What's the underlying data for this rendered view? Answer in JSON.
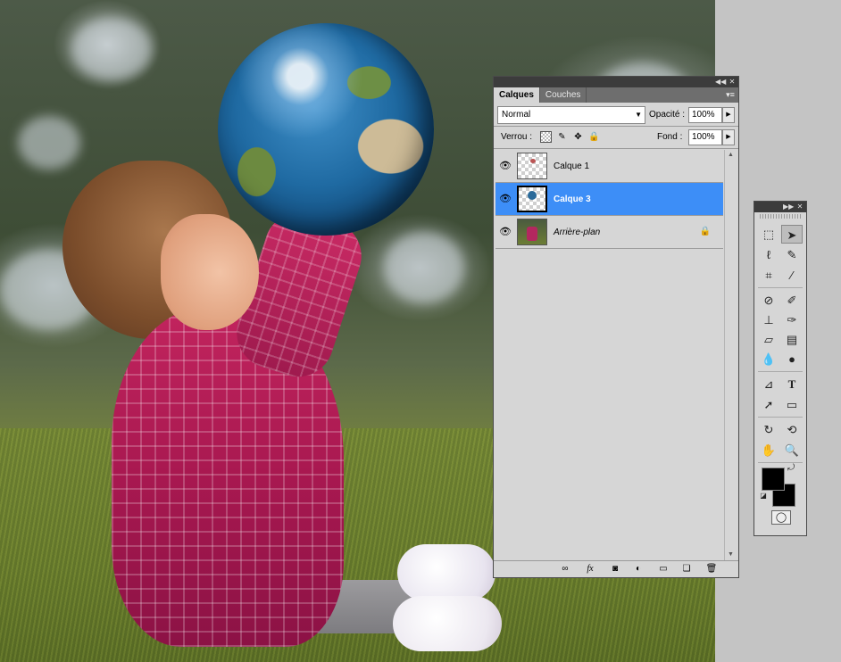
{
  "layers_panel": {
    "tabs": [
      {
        "label": "Calques",
        "active": true
      },
      {
        "label": "Couches",
        "active": false
      }
    ],
    "blend_mode": "Normal",
    "opacity_label": "Opacité :",
    "opacity_value": "100%",
    "lock_label": "Verrou :",
    "fill_label": "Fond :",
    "fill_value": "100%",
    "layers": [
      {
        "name": "Calque 1",
        "selected": false,
        "visible": true,
        "locked": false,
        "italic": false
      },
      {
        "name": "Calque 3",
        "selected": true,
        "visible": true,
        "locked": false,
        "italic": false
      },
      {
        "name": "Arrière-plan",
        "selected": false,
        "visible": true,
        "locked": true,
        "italic": true
      }
    ],
    "bottom_icons": [
      "link-icon",
      "fx-icon",
      "mask-icon",
      "adjustment-icon",
      "folder-icon",
      "new-layer-icon",
      "trash-icon"
    ],
    "fx_label": "fx"
  },
  "tools_panel": {
    "tools": [
      "marquee-icon",
      "move-icon",
      "lasso-icon",
      "quick-select-icon",
      "crop-icon",
      "eyedropper-icon",
      "healing-icon",
      "brush-icon",
      "stamp-icon",
      "history-brush-icon",
      "eraser-icon",
      "gradient-icon",
      "blur-icon",
      "dodge-icon",
      "pen-icon",
      "type-icon",
      "path-select-icon",
      "shape-icon",
      "rotate-3d-icon",
      "orbit-3d-icon",
      "hand-icon",
      "zoom-icon"
    ],
    "type_glyph": "T",
    "foreground_color": "#000000",
    "background_color": "#000000"
  }
}
